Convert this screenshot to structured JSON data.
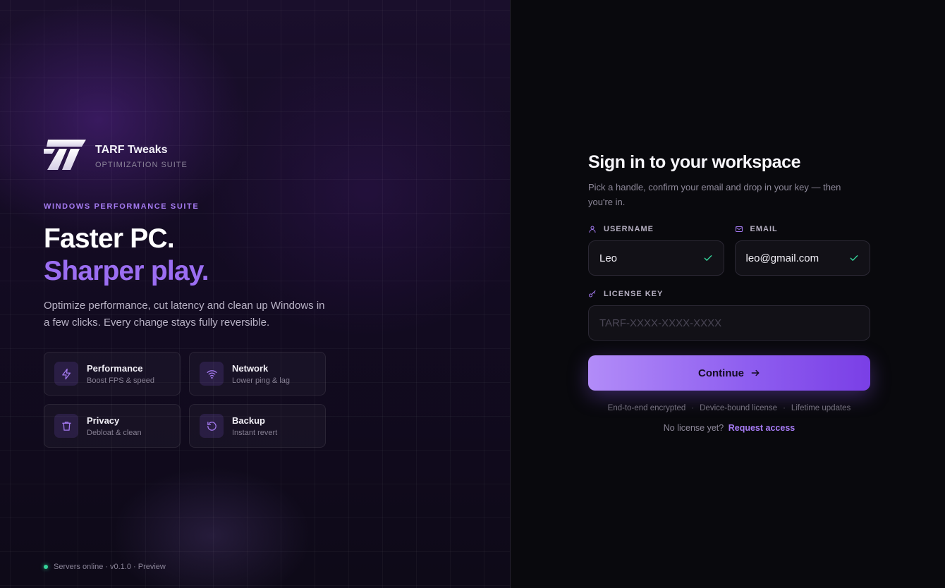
{
  "brand": {
    "name": "TARF Tweaks",
    "subtitle": "OPTIMIZATION SUITE"
  },
  "hero": {
    "eyebrow": "WINDOWS PERFORMANCE SUITE",
    "headline_line1": "Faster PC.",
    "headline_line2": "Sharper play.",
    "description": "Optimize performance, cut latency and clean up Windows in a few clicks. Every change stays fully reversible."
  },
  "features": [
    {
      "title": "Performance",
      "subtitle": "Boost FPS & speed",
      "icon": "lightning-icon"
    },
    {
      "title": "Network",
      "subtitle": "Lower ping & lag",
      "icon": "wifi-icon"
    },
    {
      "title": "Privacy",
      "subtitle": "Debloat & clean",
      "icon": "trash-icon"
    },
    {
      "title": "Backup",
      "subtitle": "Instant revert",
      "icon": "refresh-icon"
    }
  ],
  "footer": {
    "status": "Servers online",
    "version": "v0.1.0 · Preview"
  },
  "signin": {
    "title": "Sign in to your workspace",
    "subtitle": "Pick a handle, confirm your email and drop in your key — then you're in.",
    "username_label": "USERNAME",
    "username_value": "Leo",
    "email_label": "EMAIL",
    "email_value": "leo@gmail.com",
    "license_label": "LICENSE KEY",
    "license_placeholder": "TARF-XXXX-XXXX-XXXX",
    "continue_label": "Continue",
    "badges": [
      "End-to-end encrypted",
      "Device-bound license",
      "Lifetime updates"
    ],
    "no_license_text": "No license yet?",
    "request_access_label": "Request access"
  },
  "colors": {
    "accent": "#9b6ef2",
    "success": "#34d399",
    "background": "#09090d"
  }
}
